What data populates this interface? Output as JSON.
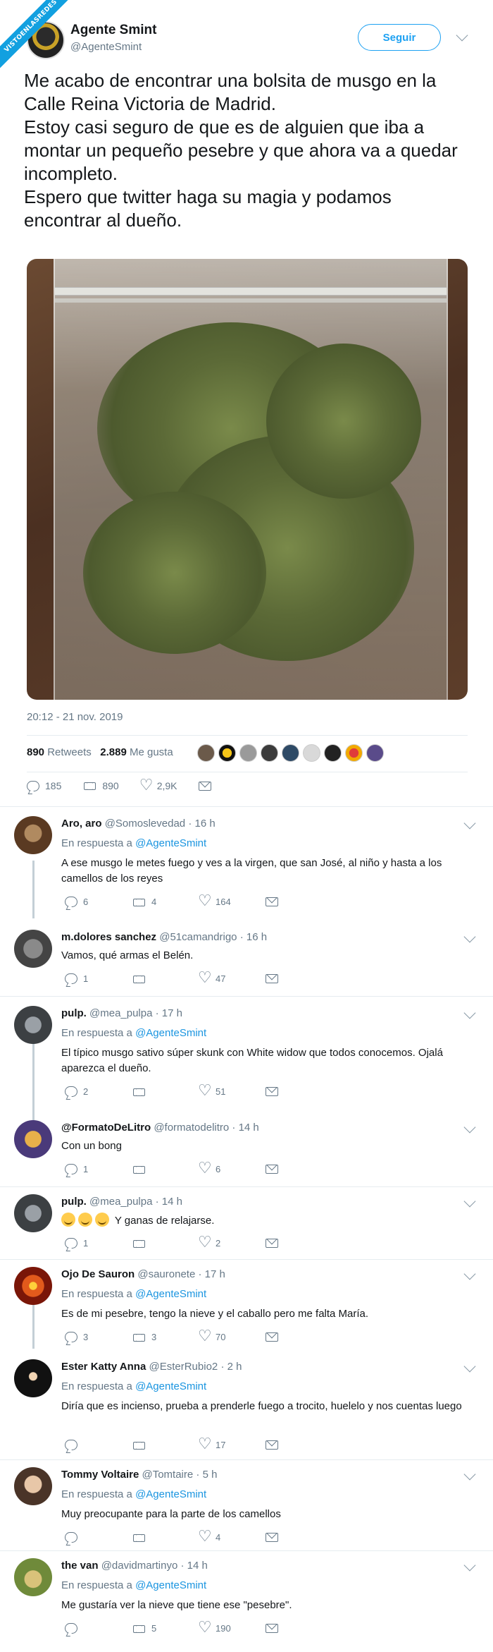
{
  "watermark": "VISTOENLASREDES",
  "tweet": {
    "author_name": "Agente Smint",
    "author_handle": "@AgenteSmint",
    "follow_label": "Seguir",
    "text_lines": [
      "Me acabo de encontrar una bolsita de musgo en la Calle Reina Victoria de Madrid.",
      "Estoy casi seguro de que es de alguien que iba a montar un pequeño pesebre y que ahora va a quedar incompleto.",
      "Espero que twitter haga su magia y podamos encontrar al dueño."
    ],
    "timestamp": "20:12 - 21 nov. 2019",
    "retweets_count": "890",
    "retweets_label": "Retweets",
    "likes_count": "2.889",
    "likes_label": "Me gusta",
    "actions": {
      "replies": "185",
      "retweets": "890",
      "likes": "2,9K"
    }
  },
  "replies": [
    {
      "name": "Aro, aro",
      "handle": "@Somoslevedad",
      "time": "· 16 h",
      "in_reply_prefix": "En respuesta a",
      "in_reply_to": "@AgenteSmint",
      "text": "A ese musgo le metes fuego y ves a la virgen,  que san José,  al niño y  hasta a los camellos de los reyes",
      "replies": "6",
      "retweets": "4",
      "likes": "164"
    },
    {
      "name": "m.dolores sanchez",
      "handle": "@51camandrigo",
      "time": "· 16 h",
      "text": "Vamos, qué armas el Belén.",
      "replies": "1",
      "retweets": "",
      "likes": "47"
    },
    {
      "name": "pulp.",
      "handle": "@mea_pulpa",
      "time": "· 17 h",
      "in_reply_prefix": "En respuesta a",
      "in_reply_to": "@AgenteSmint",
      "text": "El típico musgo sativo súper skunk con White widow que todos conocemos. Ojalá aparezca el dueño.",
      "replies": "2",
      "retweets": "",
      "likes": "51"
    },
    {
      "name": "@FormatoDeLitro",
      "handle": "@formatodelitro",
      "time": "· 14 h",
      "text": "Con un bong",
      "replies": "1",
      "retweets": "",
      "likes": "6"
    },
    {
      "name": "pulp.",
      "handle": "@mea_pulpa",
      "time": "· 14 h",
      "text": "Y ganas de relajarse.",
      "replies": "1",
      "retweets": "",
      "likes": "2"
    },
    {
      "name": "Ojo De Sauron",
      "handle": "@sauronete",
      "time": "· 17 h",
      "in_reply_prefix": "En respuesta a",
      "in_reply_to": "@AgenteSmint",
      "text": "Es de mi pesebre, tengo la nieve y el caballo pero me falta María.",
      "replies": "3",
      "retweets": "3",
      "likes": "70"
    },
    {
      "name": "Ester Katty Anna",
      "handle": "@EsterRubio2",
      "time": "· 2 h",
      "in_reply_prefix": "En respuesta a",
      "in_reply_to": "@AgenteSmint",
      "text": "Diría que es incienso, prueba a prenderle fuego a trocito, huelelo y nos cuentas luego",
      "replies": "",
      "retweets": "",
      "likes": "17"
    },
    {
      "name": "Tommy Voltaire",
      "handle": "@Tomtaire",
      "time": "· 5 h",
      "in_reply_prefix": "En respuesta a",
      "in_reply_to": "@AgenteSmint",
      "text": "Muy preocupante para la parte de los camellos",
      "replies": "",
      "retweets": "",
      "likes": "4"
    },
    {
      "name": "the van",
      "handle": "@davidmartinyo",
      "time": "· 14 h",
      "in_reply_prefix": "En respuesta a",
      "in_reply_to": "@AgenteSmint",
      "text": "Me gustaría ver la nieve que tiene ese \"pesebre\".",
      "replies": "",
      "retweets": "5",
      "likes": "190"
    }
  ],
  "colors": {
    "accent": "#1da1f2",
    "link": "#1b95e0",
    "muted": "#657786",
    "thread_line": "#c4cfd6"
  }
}
